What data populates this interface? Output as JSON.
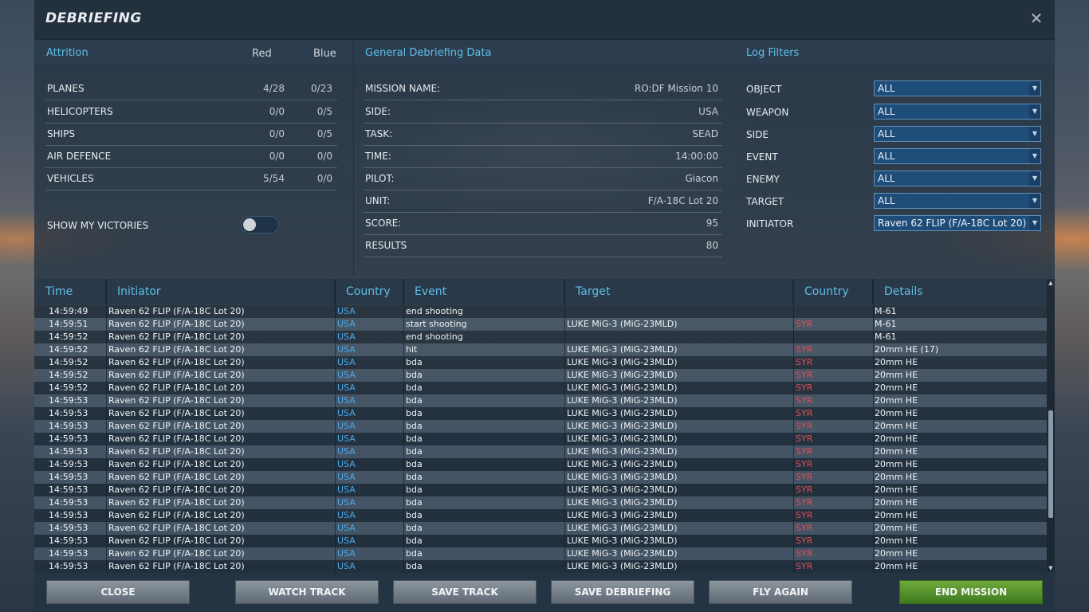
{
  "window": {
    "title": "DEBRIEFING",
    "close_symbol": "✕"
  },
  "attrition": {
    "header": "Attrition",
    "col_red": "Red",
    "col_blue": "Blue",
    "rows": [
      {
        "label": "PLANES",
        "red": "4/28",
        "blue": "0/23"
      },
      {
        "label": "HELICOPTERS",
        "red": "0/0",
        "blue": "0/5"
      },
      {
        "label": "SHIPS",
        "red": "0/0",
        "blue": "0/5"
      },
      {
        "label": "AIR DEFENCE",
        "red": "0/0",
        "blue": "0/0"
      },
      {
        "label": "VEHICLES",
        "red": "5/54",
        "blue": "0/0"
      }
    ],
    "show_victories_label": "SHOW MY VICTORIES",
    "show_victories_on": false
  },
  "general": {
    "header": "General Debriefing Data",
    "rows": [
      {
        "label": "MISSION NAME:",
        "value": "RO:DF Mission 10"
      },
      {
        "label": "SIDE:",
        "value": "USA"
      },
      {
        "label": "TASK:",
        "value": "SEAD"
      },
      {
        "label": "TIME:",
        "value": "14:00:00"
      },
      {
        "label": "PILOT:",
        "value": "Giacon"
      },
      {
        "label": "UNIT:",
        "value": "F/A-18C Lot 20"
      },
      {
        "label": "SCORE:",
        "value": "95"
      },
      {
        "label": "RESULTS",
        "value": "80"
      }
    ]
  },
  "filters": {
    "header": "Log Filters",
    "rows": [
      {
        "label": "OBJECT",
        "value": "ALL"
      },
      {
        "label": "WEAPON",
        "value": "ALL"
      },
      {
        "label": "SIDE",
        "value": "ALL"
      },
      {
        "label": "EVENT",
        "value": "ALL"
      },
      {
        "label": "ENEMY",
        "value": "ALL"
      },
      {
        "label": "TARGET",
        "value": "ALL"
      },
      {
        "label": "INITIATOR",
        "value": "Raven 62 FLIP (F/A-18C Lot 20)"
      }
    ]
  },
  "log": {
    "headers": {
      "time": "Time",
      "initiator": "Initiator",
      "country": "Country",
      "event": "Event",
      "target": "Target",
      "target_country": "Country",
      "details": "Details"
    },
    "rows": [
      {
        "time": "14:59:49",
        "initiator": "Raven 62 FLIP (F/A-18C Lot 20)",
        "country": "USA",
        "event": "end shooting",
        "target": "",
        "target_country": "",
        "details": "M-61"
      },
      {
        "time": "14:59:51",
        "initiator": "Raven 62 FLIP (F/A-18C Lot 20)",
        "country": "USA",
        "event": "start shooting",
        "target": "LUKE MiG-3 (MiG-23MLD)",
        "target_country": "SYR",
        "details": "M-61"
      },
      {
        "time": "14:59:52",
        "initiator": "Raven 62 FLIP (F/A-18C Lot 20)",
        "country": "USA",
        "event": "end shooting",
        "target": "",
        "target_country": "",
        "details": "M-61"
      },
      {
        "time": "14:59:52",
        "initiator": "Raven 62 FLIP (F/A-18C Lot 20)",
        "country": "USA",
        "event": "hit",
        "target": "LUKE MiG-3 (MiG-23MLD)",
        "target_country": "SYR",
        "details": "20mm HE (17)"
      },
      {
        "time": "14:59:52",
        "initiator": "Raven 62 FLIP (F/A-18C Lot 20)",
        "country": "USA",
        "event": "bda",
        "target": "LUKE MiG-3 (MiG-23MLD)",
        "target_country": "SYR",
        "details": "20mm HE"
      },
      {
        "time": "14:59:52",
        "initiator": "Raven 62 FLIP (F/A-18C Lot 20)",
        "country": "USA",
        "event": "bda",
        "target": "LUKE MiG-3 (MiG-23MLD)",
        "target_country": "SYR",
        "details": "20mm HE"
      },
      {
        "time": "14:59:52",
        "initiator": "Raven 62 FLIP (F/A-18C Lot 20)",
        "country": "USA",
        "event": "bda",
        "target": "LUKE MiG-3 (MiG-23MLD)",
        "target_country": "SYR",
        "details": "20mm HE"
      },
      {
        "time": "14:59:53",
        "initiator": "Raven 62 FLIP (F/A-18C Lot 20)",
        "country": "USA",
        "event": "bda",
        "target": "LUKE MiG-3 (MiG-23MLD)",
        "target_country": "SYR",
        "details": "20mm HE"
      },
      {
        "time": "14:59:53",
        "initiator": "Raven 62 FLIP (F/A-18C Lot 20)",
        "country": "USA",
        "event": "bda",
        "target": "LUKE MiG-3 (MiG-23MLD)",
        "target_country": "SYR",
        "details": "20mm HE"
      },
      {
        "time": "14:59:53",
        "initiator": "Raven 62 FLIP (F/A-18C Lot 20)",
        "country": "USA",
        "event": "bda",
        "target": "LUKE MiG-3 (MiG-23MLD)",
        "target_country": "SYR",
        "details": "20mm HE"
      },
      {
        "time": "14:59:53",
        "initiator": "Raven 62 FLIP (F/A-18C Lot 20)",
        "country": "USA",
        "event": "bda",
        "target": "LUKE MiG-3 (MiG-23MLD)",
        "target_country": "SYR",
        "details": "20mm HE"
      },
      {
        "time": "14:59:53",
        "initiator": "Raven 62 FLIP (F/A-18C Lot 20)",
        "country": "USA",
        "event": "bda",
        "target": "LUKE MiG-3 (MiG-23MLD)",
        "target_country": "SYR",
        "details": "20mm HE"
      },
      {
        "time": "14:59:53",
        "initiator": "Raven 62 FLIP (F/A-18C Lot 20)",
        "country": "USA",
        "event": "bda",
        "target": "LUKE MiG-3 (MiG-23MLD)",
        "target_country": "SYR",
        "details": "20mm HE"
      },
      {
        "time": "14:59:53",
        "initiator": "Raven 62 FLIP (F/A-18C Lot 20)",
        "country": "USA",
        "event": "bda",
        "target": "LUKE MiG-3 (MiG-23MLD)",
        "target_country": "SYR",
        "details": "20mm HE"
      },
      {
        "time": "14:59:53",
        "initiator": "Raven 62 FLIP (F/A-18C Lot 20)",
        "country": "USA",
        "event": "bda",
        "target": "LUKE MiG-3 (MiG-23MLD)",
        "target_country": "SYR",
        "details": "20mm HE"
      },
      {
        "time": "14:59:53",
        "initiator": "Raven 62 FLIP (F/A-18C Lot 20)",
        "country": "USA",
        "event": "bda",
        "target": "LUKE MiG-3 (MiG-23MLD)",
        "target_country": "SYR",
        "details": "20mm HE"
      },
      {
        "time": "14:59:53",
        "initiator": "Raven 62 FLIP (F/A-18C Lot 20)",
        "country": "USA",
        "event": "bda",
        "target": "LUKE MiG-3 (MiG-23MLD)",
        "target_country": "SYR",
        "details": "20mm HE"
      },
      {
        "time": "14:59:53",
        "initiator": "Raven 62 FLIP (F/A-18C Lot 20)",
        "country": "USA",
        "event": "bda",
        "target": "LUKE MiG-3 (MiG-23MLD)",
        "target_country": "SYR",
        "details": "20mm HE"
      },
      {
        "time": "14:59:53",
        "initiator": "Raven 62 FLIP (F/A-18C Lot 20)",
        "country": "USA",
        "event": "bda",
        "target": "LUKE MiG-3 (MiG-23MLD)",
        "target_country": "SYR",
        "details": "20mm HE"
      },
      {
        "time": "14:59:53",
        "initiator": "Raven 62 FLIP (F/A-18C Lot 20)",
        "country": "USA",
        "event": "bda",
        "target": "LUKE MiG-3 (MiG-23MLD)",
        "target_country": "SYR",
        "details": "20mm HE"
      },
      {
        "time": "14:59:53",
        "initiator": "Raven 62 FLIP (F/A-18C Lot 20)",
        "country": "USA",
        "event": "bda",
        "target": "LUKE MiG-3 (MiG-23MLD)",
        "target_country": "SYR",
        "details": "20mm HE"
      }
    ]
  },
  "buttons": {
    "close": "CLOSE",
    "watch_track": "WATCH TRACK",
    "save_track": "SAVE TRACK",
    "save_debriefing": "SAVE DEBRIEFING",
    "fly_again": "FLY AGAIN",
    "end_mission": "END MISSION"
  },
  "colors": {
    "accent": "#5fbfe8",
    "country_blue": "#4aa8e8",
    "country_red": "#e05050",
    "end_mission_green": "#5a9a2e"
  }
}
